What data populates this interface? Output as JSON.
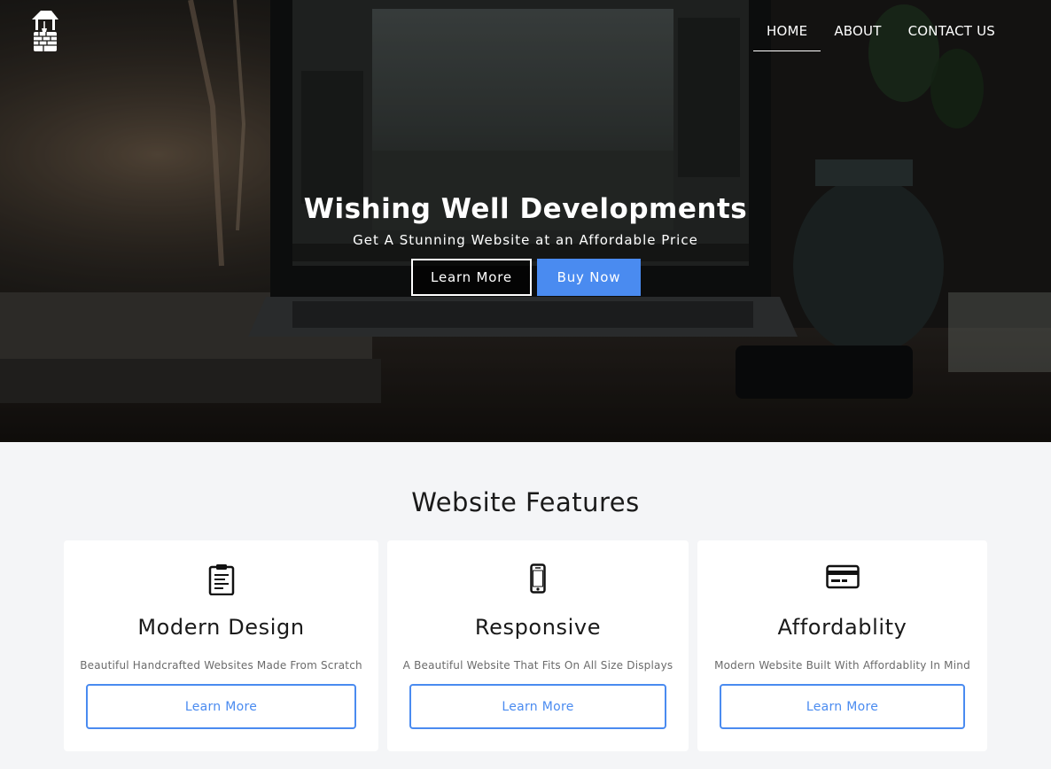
{
  "nav": {
    "items": [
      {
        "label": "HOME",
        "active": true
      },
      {
        "label": "ABOUT",
        "active": false
      },
      {
        "label": "CONTACT US",
        "active": false
      }
    ]
  },
  "hero": {
    "title": "Wishing Well Developments",
    "subtitle": "Get A Stunning Website at an Affordable Price",
    "learn_more_label": "Learn More",
    "buy_now_label": "Buy Now"
  },
  "features": {
    "title": "Website Features",
    "cards": [
      {
        "icon": "clipboard-icon",
        "title": "Modern Design",
        "description": "Beautiful Handcrafted Websites Made From Scratch",
        "button_label": "Learn More"
      },
      {
        "icon": "mobile-phone-icon",
        "title": "Responsive",
        "description": "A Beautiful Website That Fits On All Size Displays",
        "button_label": "Learn More"
      },
      {
        "icon": "credit-card-icon",
        "title": "Affordablity",
        "description": "Modern Website Built With Affordablity In Mind",
        "button_label": "Learn More"
      }
    ]
  },
  "colors": {
    "accent": "#4a8bf0",
    "page_background": "#f4f5f7",
    "card_background": "#ffffff"
  }
}
